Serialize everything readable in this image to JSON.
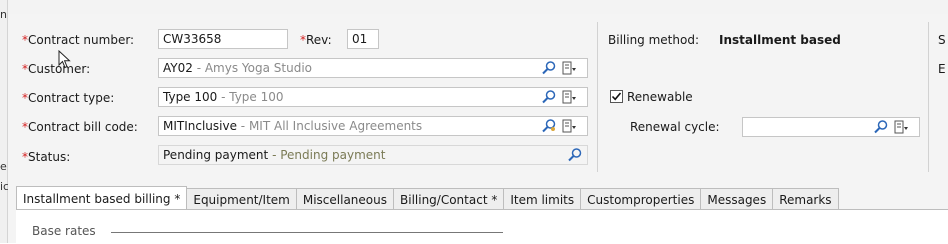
{
  "left_edge": {
    "chars": [
      "n",
      "e",
      "ic"
    ]
  },
  "header": {
    "contract_number_label": "Contract number:",
    "contract_number_value": "CW33658",
    "rev_label": "Rev:",
    "rev_value": "01",
    "customer_label": "Customer:",
    "customer_code": "AY02",
    "customer_desc": " - Amys Yoga Studio",
    "contract_type_label": "Contract type:",
    "contract_type_code": "Type 100",
    "contract_type_desc": " - Type 100",
    "bill_code_label": "Contract bill code:",
    "bill_code_code": "MITInclusive",
    "bill_code_desc": " - MIT All Inclusive Agreements",
    "status_label": "Status:",
    "status_code": "Pending payment",
    "status_desc": " - Pending payment",
    "required_marker": "*"
  },
  "right": {
    "billing_method_label": "Billing method:",
    "billing_method_value": "Installment based",
    "renewable_label": "Renewable",
    "renewable_checked": true,
    "renewal_cycle_label": "Renewal cycle:",
    "renewal_cycle_value": "",
    "edge_s": "S",
    "edge_e": "E"
  },
  "tabs": [
    {
      "label": "Installment based billing *",
      "active": true
    },
    {
      "label": "Equipment/Item",
      "active": false
    },
    {
      "label": "Miscellaneous",
      "active": false
    },
    {
      "label": "Billing/Contact *",
      "active": false
    },
    {
      "label": "Item limits",
      "active": false
    },
    {
      "label": "Customproperties",
      "active": false
    },
    {
      "label": "Messages",
      "active": false
    },
    {
      "label": "Remarks",
      "active": false
    }
  ],
  "tab_body": {
    "section_label": "Base rates"
  },
  "colors": {
    "required": "#d42020",
    "highlight": "#f3f16e",
    "desc_text": "#8a8a8a"
  },
  "icons": [
    "search-icon",
    "picker-icon",
    "dropdown-arrow-icon",
    "checkmark-icon",
    "mouse-cursor-icon"
  ]
}
